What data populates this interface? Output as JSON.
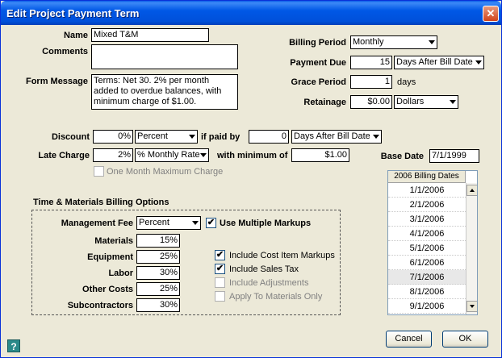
{
  "window": {
    "title": "Edit Project Payment Term"
  },
  "name": {
    "label": "Name",
    "value": "Mixed T&M"
  },
  "comments": {
    "label": "Comments",
    "value": ""
  },
  "form_message": {
    "label": "Form Message",
    "value": "Terms:  Net 30.  2% per month added to overdue balances, with minimum charge of $1.00."
  },
  "billing_period": {
    "label": "Billing Period",
    "value": "Monthly"
  },
  "payment_due": {
    "label": "Payment Due",
    "value": "15",
    "unit": "Days After Bill Date"
  },
  "grace_period": {
    "label": "Grace Period",
    "value": "1",
    "unit": "days"
  },
  "retainage": {
    "label": "Retainage",
    "value": "$0.00",
    "unit": "Dollars"
  },
  "discount": {
    "label": "Discount",
    "value": "0%",
    "type": "Percent",
    "if_paid_by_label": "if paid by",
    "days": "0",
    "unit": "Days After Bill Date"
  },
  "late_charge": {
    "label": "Late Charge",
    "value": "2%",
    "type": "% Monthly Rate",
    "minimum_label": "with minimum of",
    "minimum": "$1.00"
  },
  "base_date": {
    "label": "Base Date",
    "value": "7/1/1999"
  },
  "one_month_max": {
    "label": "One Month Maximum Charge",
    "checked": false,
    "disabled": true
  },
  "tm": {
    "section_label": "Time & Materials Billing Options",
    "management_fee": {
      "label": "Management Fee",
      "value": "Percent"
    },
    "use_multiple_markups": {
      "label": "Use Multiple Markups",
      "checked": true
    },
    "materials": {
      "label": "Materials",
      "value": "15%"
    },
    "equipment": {
      "label": "Equipment",
      "value": "25%"
    },
    "labor": {
      "label": "Labor",
      "value": "30%"
    },
    "other_costs": {
      "label": "Other Costs",
      "value": "25%"
    },
    "subcontractors": {
      "label": "Subcontractors",
      "value": "30%"
    },
    "options": [
      {
        "label": "Include Cost Item Markups",
        "checked": true,
        "disabled": false
      },
      {
        "label": "Include Sales Tax",
        "checked": true,
        "disabled": false
      },
      {
        "label": "Include Adjustments",
        "checked": false,
        "disabled": true
      },
      {
        "label": "Apply To Materials Only",
        "checked": false,
        "disabled": true
      }
    ]
  },
  "billing_dates": {
    "header": "2006 Billing Dates",
    "rows": [
      "1/1/2006",
      "2/1/2006",
      "3/1/2006",
      "4/1/2006",
      "5/1/2006",
      "6/1/2006",
      "7/1/2006",
      "8/1/2006",
      "9/1/2006"
    ]
  },
  "buttons": {
    "cancel": "Cancel",
    "ok": "OK",
    "help": "?"
  },
  "check_glyph": "✔",
  "colors": {
    "titlebar": "#0058e6",
    "close": "#d2431a",
    "dialog": "#ece9d8"
  }
}
